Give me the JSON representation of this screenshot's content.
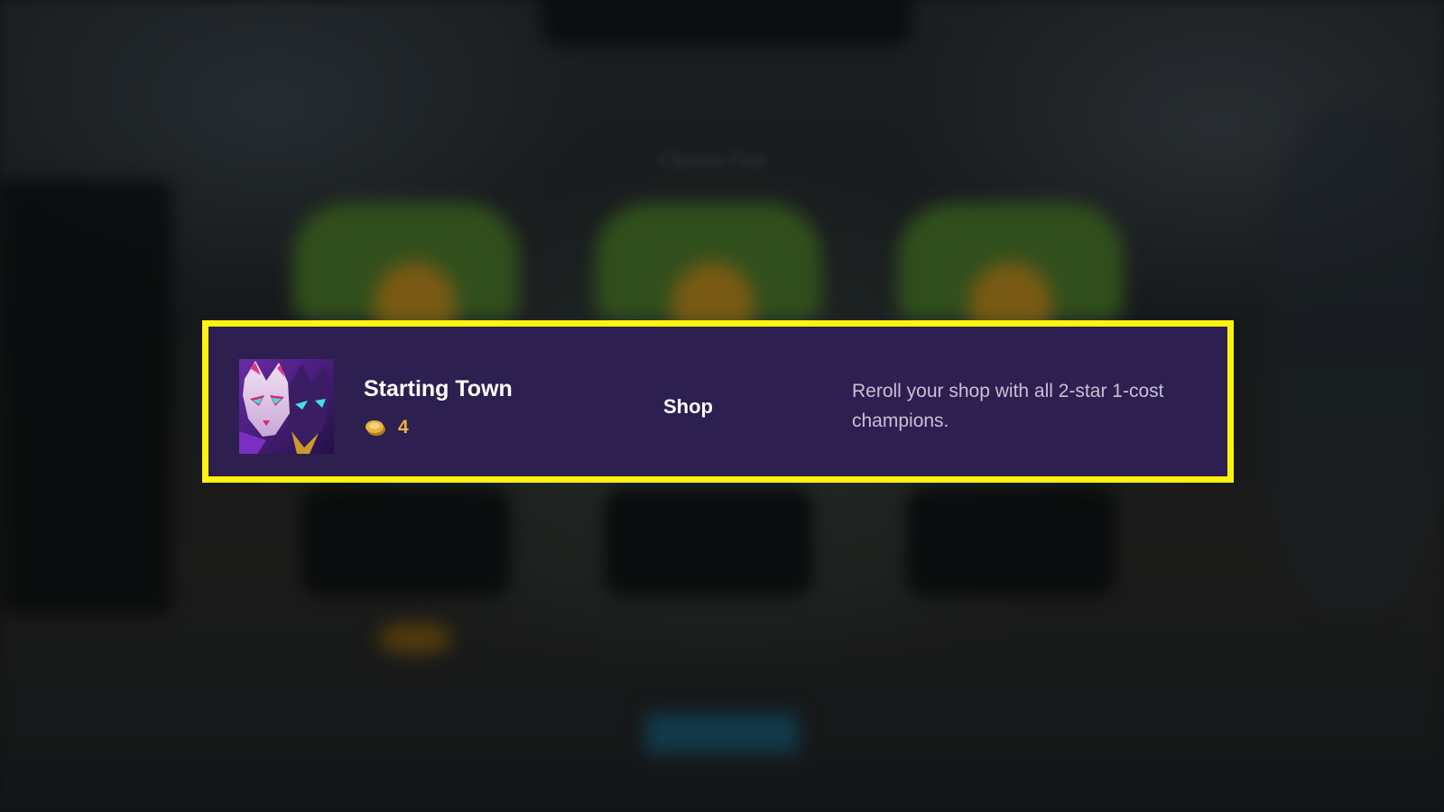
{
  "augment": {
    "name": "Starting Town",
    "cost": "4",
    "category": "Shop",
    "description": "Reroll your shop with all 2-star 1-cost champions."
  },
  "background": {
    "title": "Choose One"
  },
  "colors": {
    "highlight_border": "#fcf310",
    "card_background": "#2d1f4f",
    "cost_gold": "#e8b540",
    "description_text": "#c9bfd8"
  },
  "icons": {
    "portrait": "kitsune-mask-champion-portrait",
    "cost": "gold-coin-icon"
  }
}
